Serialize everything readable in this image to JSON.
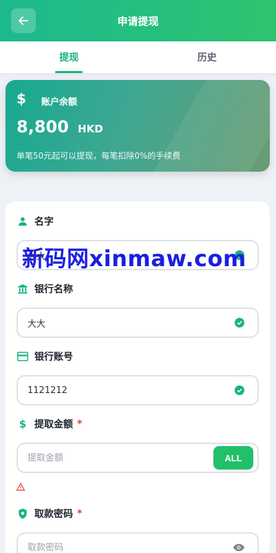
{
  "header": {
    "title": "申请提现",
    "back_icon": "arrow-left-icon"
  },
  "tabs": [
    {
      "label": "提现",
      "active": true
    },
    {
      "label": "历史",
      "active": false
    }
  ],
  "balance": {
    "label": "账户余额",
    "amount": "8,800",
    "currency": "HKD",
    "note": "单笔50元起可以提现，每笔扣除0%的手续费"
  },
  "form": {
    "name": {
      "label": "名字",
      "value": "大大"
    },
    "bank_name": {
      "label": "银行名称",
      "value": "大大"
    },
    "bank_account": {
      "label": "银行账号",
      "value": "1121212"
    },
    "amount": {
      "label": "提取金额",
      "required": "*",
      "placeholder": "提取金额",
      "all_label": "ALL"
    },
    "password": {
      "label": "取款密码",
      "required": "*",
      "placeholder": "取款密码"
    }
  },
  "watermark": "新码网xinmaw.com",
  "colors": {
    "accent": "#17b57b",
    "button": "#22c06a",
    "required": "#e23b3b"
  }
}
